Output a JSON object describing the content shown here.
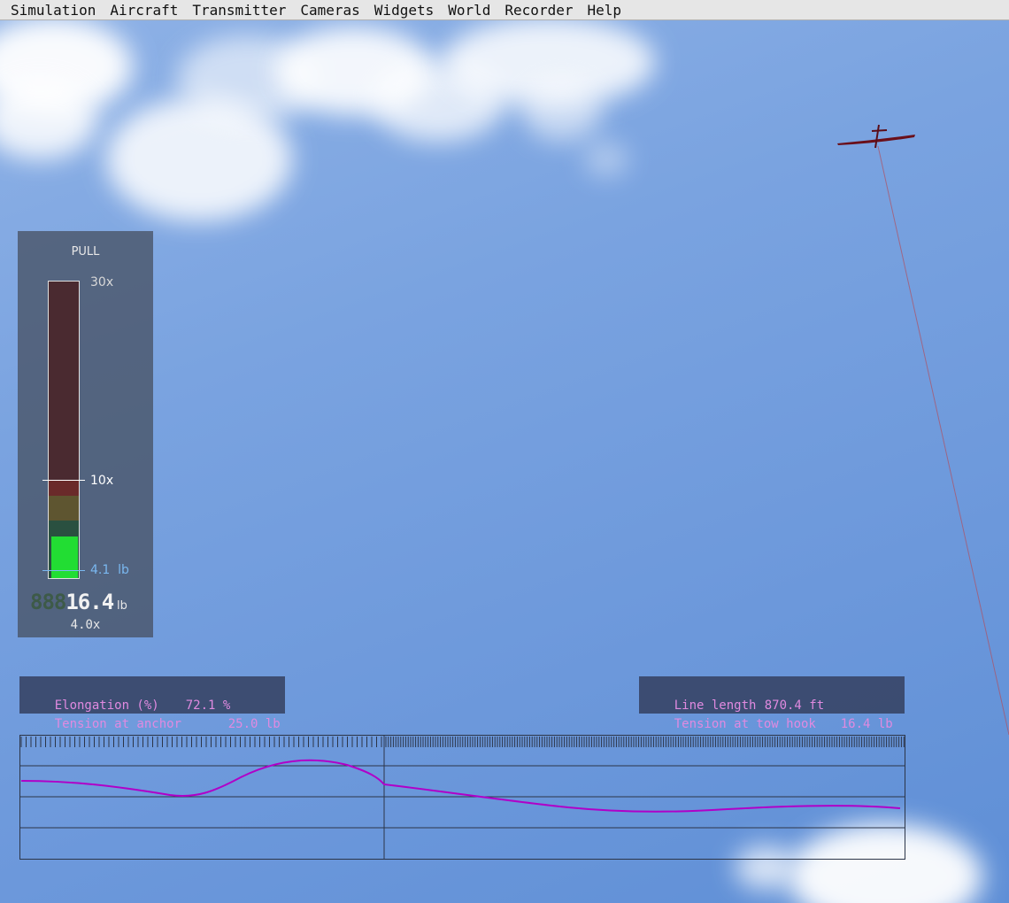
{
  "menu": {
    "items": [
      "Simulation",
      "Aircraft",
      "Transmitter",
      "Cameras",
      "Widgets",
      "World",
      "Recorder",
      "Help"
    ]
  },
  "pull_widget": {
    "title": "PULL",
    "scale_top_label": "30x",
    "scale_mid_label": "10x",
    "reference_label": "4.1  lb",
    "lcd_ghost": "888",
    "lcd_value": "16.4",
    "unit": "lb",
    "multiplier": "4.0x",
    "fill_fraction": 0.133
  },
  "stats_left": {
    "rows": [
      {
        "label": "Elongation (%)",
        "value": "72.1 %"
      },
      {
        "label": "Tension at anchor",
        "value": "25.0 lb"
      }
    ]
  },
  "stats_right": {
    "rows": [
      {
        "label": "Line length",
        "value": "870.4 ft"
      },
      {
        "label": "Tension at tow hook",
        "value": "16.4 lb"
      }
    ]
  },
  "colors": {
    "menu_bg": "#e6e6e6",
    "stat_text": "#e08ae0",
    "fill_green": "#22dd33",
    "line_color": "#b000c8",
    "tow_line": "#b05060",
    "glider": "#6a0f1a"
  }
}
